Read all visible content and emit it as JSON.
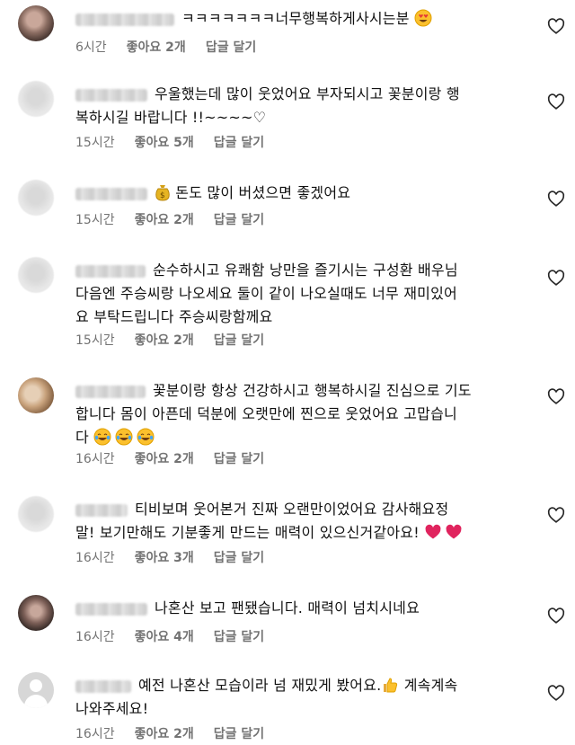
{
  "comments": [
    {
      "text": "ㅋㅋㅋㅋㅋㅋㅋ너무행복하게사시는분",
      "time": "6시간",
      "likes": "좋아요 2개",
      "reply": "답글 달기"
    },
    {
      "text": "우울했는데 많이 웃었어요 부자되시고 꽃분이랑 행복하시길 바랍니다 !!~~~~♡",
      "line1": "우울했는데 많이 웃었어요 부자되시고 꽃분이랑 행",
      "line2": "복하시길 바랍니다 !!~~~~♡",
      "time": "15시간",
      "likes": "좋아요 5개",
      "reply": "답글 달기"
    },
    {
      "text": "돈도 많이 버셨으면 좋겠어요",
      "time": "15시간",
      "likes": "좋아요 2개",
      "reply": "답글 달기"
    },
    {
      "line1": "순수하시고 유쾌함 낭만을 즐기시는 구성환 배우님",
      "line2": "다음엔 주승씨랑 나오세요 둘이 같이 나오실때도 너무 재미있어",
      "line3": "요 부탁드립니다 주승씨랑함께요",
      "time": "15시간",
      "likes": "좋아요 2개",
      "reply": "답글 달기"
    },
    {
      "line1": "꽃분이랑 항상 건강하시고 행복하시길 진심으로 기도",
      "line2": "합니다 몸이 아픈데 덕분에 오랫만에 찐으로 웃었어요 고맙습니",
      "line3": "다",
      "time": "16시간",
      "likes": "좋아요 2개",
      "reply": "답글 달기"
    },
    {
      "line1": "티비보며 웃어본거 진짜 오랜만이었어요 감사해요정",
      "line2": "말! 보기만해도 기분좋게 만드는 매력이 있으신거같아요!",
      "time": "16시간",
      "likes": "좋아요 3개",
      "reply": "답글 달기"
    },
    {
      "text": "나혼산 보고 팬됐습니다. 매력이 넘치시네요",
      "time": "16시간",
      "likes": "좋아요 4개",
      "reply": "답글 달기"
    },
    {
      "line1": "예전 나혼산 모습이라 넘 재밌게 봤어요.",
      "line1b": "계속계속",
      "line2": "나와주세요!",
      "time": "16시간",
      "likes": "좋아요 2개",
      "reply": "답글 달기"
    }
  ],
  "icons": {
    "like": "heart-outline-icon",
    "emoji_heart_eyes": "heart-eyes-emoji",
    "emoji_money": "money-bag-emoji",
    "emoji_laugh": "tears-of-joy-emoji",
    "emoji_red_heart": "red-heart-emoji",
    "emoji_thumbs": "thumbs-up-emoji"
  },
  "colors": {
    "meta": "#737373",
    "heart_red": "#e0245e"
  }
}
